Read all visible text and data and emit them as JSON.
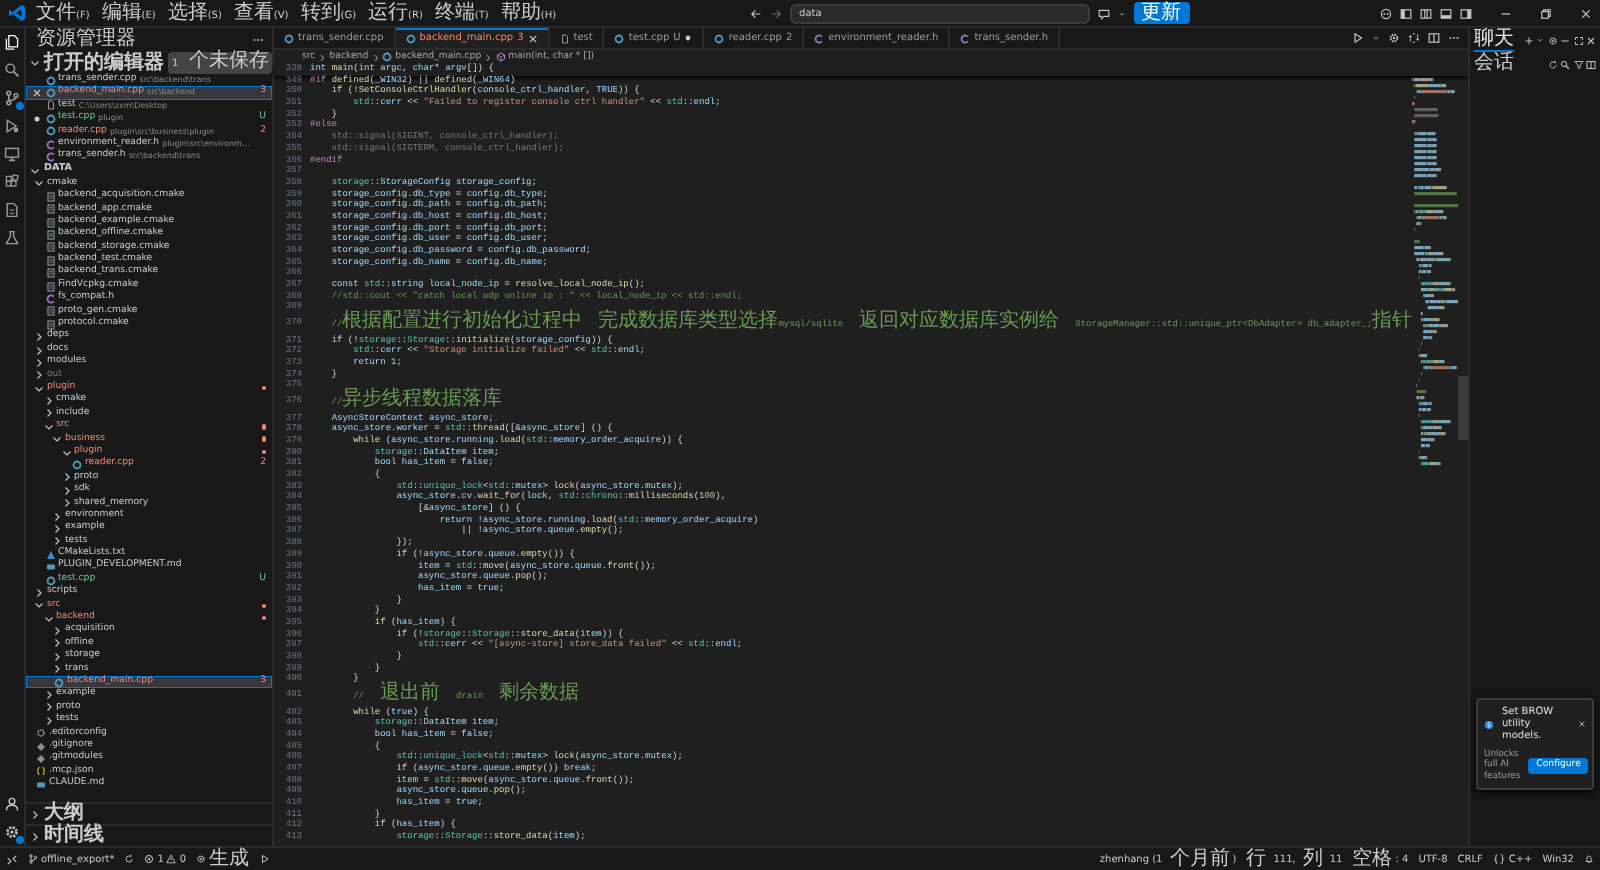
{
  "title_bar": {
    "menus": [
      "文件(F)",
      "编辑(E)",
      "选择(S)",
      "查看(V)",
      "转到(G)",
      "运行(R)",
      "终端(T)",
      "帮助(H)"
    ],
    "search": {
      "value": "data"
    },
    "update_button": "更新"
  },
  "activity_bar": {
    "items": [
      {
        "kind": "explorer",
        "selected": true,
        "badge": false
      },
      {
        "kind": "search",
        "selected": false,
        "badge": false
      },
      {
        "kind": "source-control",
        "selected": false,
        "badge": true
      },
      {
        "kind": "run-debug",
        "selected": false,
        "badge": false
      },
      {
        "kind": "remote",
        "selected": false,
        "badge": false
      },
      {
        "kind": "extensions",
        "selected": false,
        "badge": false
      },
      {
        "kind": "document",
        "selected": false,
        "badge": false
      },
      {
        "kind": "flask",
        "selected": false,
        "badge": false
      }
    ],
    "bottom": [
      {
        "kind": "account",
        "badge": false
      },
      {
        "kind": "settings",
        "badge": true
      }
    ]
  },
  "sidebar": {
    "title": "资源管理器",
    "open_editors": {
      "label": "打开的编辑器",
      "expanded": true,
      "badge": "1 个未保存",
      "items": [
        {
          "name": "trans_sender.cpp",
          "kind": "cpp",
          "path": "src\\backend\\trans",
          "selected": false,
          "dirty": false
        },
        {
          "name": "backend_main.cpp",
          "kind": "cpp",
          "path": "src\\backend",
          "badge": "3",
          "error": true,
          "selected": true,
          "dirty": false
        },
        {
          "name": "test",
          "kind": "file",
          "path": "C:\\Users\\zxm\\Desktop",
          "selected": false,
          "dirty": false
        },
        {
          "name": "test.cpp",
          "kind": "cpp",
          "path": "plugin",
          "badge": "U",
          "untracked": true,
          "selected": false,
          "dirty": true
        },
        {
          "name": "reader.cpp",
          "kind": "cpp",
          "path": "plugin\\src\\business\\plugin",
          "badge": "2",
          "error": true,
          "selected": false,
          "dirty": false
        },
        {
          "name": "environment_reader.h",
          "kind": "h",
          "path": "plugin\\src\\environm…",
          "selected": false,
          "dirty": false
        },
        {
          "name": "trans_sender.h",
          "kind": "h",
          "path": "src\\backend\\trans",
          "selected": false,
          "dirty": false
        }
      ]
    },
    "workspace": {
      "label": "DATA",
      "expanded": true,
      "tree": [
        {
          "label": "cmake",
          "kind": "folder",
          "expanded": true,
          "selected": false,
          "children": [
            {
              "label": "backend_acquisition.cmake",
              "kind": "cmake",
              "selected": false
            },
            {
              "label": "backend_app.cmake",
              "kind": "cmake",
              "selected": false
            },
            {
              "label": "backend_example.cmake",
              "kind": "cmake",
              "selected": false
            },
            {
              "label": "backend_offline.cmake",
              "kind": "cmake",
              "selected": false
            },
            {
              "label": "backend_storage.cmake",
              "kind": "cmake",
              "selected": false
            },
            {
              "label": "backend_test.cmake",
              "kind": "cmake",
              "selected": false
            },
            {
              "label": "backend_trans.cmake",
              "kind": "cmake",
              "selected": false
            },
            {
              "label": "FindVcpkg.cmake",
              "kind": "cmake",
              "selected": false
            },
            {
              "label": "fs_compat.h",
              "kind": "h",
              "selected": false
            },
            {
              "label": "proto_gen.cmake",
              "kind": "cmake",
              "selected": false
            },
            {
              "label": "protocol.cmake",
              "kind": "cmake",
              "selected": false
            }
          ]
        },
        {
          "label": "deps",
          "kind": "folder",
          "expanded": false,
          "selected": false
        },
        {
          "label": "docs",
          "kind": "folder",
          "expanded": false,
          "selected": false
        },
        {
          "label": "modules",
          "kind": "folder",
          "expanded": false,
          "selected": false
        },
        {
          "label": "out",
          "kind": "folder",
          "expanded": false,
          "selected": false,
          "ignored": true
        },
        {
          "label": "plugin",
          "kind": "folder",
          "expanded": true,
          "selected": false,
          "error": true,
          "children": [
            {
              "label": "cmake",
              "kind": "folder",
              "expanded": false,
              "selected": false
            },
            {
              "label": "include",
              "kind": "folder",
              "expanded": false,
              "selected": false
            },
            {
              "label": "src",
              "kind": "folder",
              "expanded": true,
              "selected": false,
              "error": true,
              "children": [
                {
                  "label": "business",
                  "kind": "folder",
                  "expanded": true,
                  "selected": false,
                  "error": true,
                  "children": [
                    {
                      "label": "plugin",
                      "kind": "folder",
                      "expanded": true,
                      "selected": false,
                      "error": true,
                      "children": [
                        {
                          "label": "reader.cpp",
                          "kind": "cpp",
                          "selected": false,
                          "error": true,
                          "badge": "2"
                        }
                      ]
                    },
                    {
                      "label": "proto",
                      "kind": "folder",
                      "expanded": false,
                      "selected": false
                    },
                    {
                      "label": "sdk",
                      "kind": "folder",
                      "expanded": false,
                      "selected": false
                    },
                    {
                      "label": "shared_memory",
                      "kind": "folder",
                      "expanded": false,
                      "selected": false
                    }
                  ]
                },
                {
                  "label": "environment",
                  "kind": "folder",
                  "expanded": false,
                  "selected": false
                },
                {
                  "label": "example",
                  "kind": "folder",
                  "expanded": false,
                  "selected": false
                },
                {
                  "label": "tests",
                  "kind": "folder",
                  "expanded": false,
                  "selected": false
                }
              ]
            },
            {
              "label": "CMakeLists.txt",
              "kind": "txt",
              "selected": false
            },
            {
              "label": "PLUGIN_DEVELOPMENT.md",
              "kind": "md",
              "selected": false
            },
            {
              "label": "test.cpp",
              "kind": "cpp",
              "selected": false,
              "untracked": true,
              "badge": "U"
            }
          ]
        },
        {
          "label": "scripts",
          "kind": "folder",
          "expanded": false,
          "selected": false
        },
        {
          "label": "src",
          "kind": "folder",
          "expanded": true,
          "selected": false,
          "error": true,
          "children": [
            {
              "label": "backend",
              "kind": "folder",
              "expanded": true,
              "selected": false,
              "error": true,
              "children": [
                {
                  "label": "acquisition",
                  "kind": "folder",
                  "expanded": false,
                  "selected": false
                },
                {
                  "label": "offline",
                  "kind": "folder",
                  "expanded": false,
                  "selected": false
                },
                {
                  "label": "storage",
                  "kind": "folder",
                  "expanded": false,
                  "selected": false
                },
                {
                  "label": "trans",
                  "kind": "folder",
                  "expanded": false,
                  "selected": false
                },
                {
                  "label": "backend_main.cpp",
                  "kind": "cpp",
                  "selected": true,
                  "error": true,
                  "badge": "3"
                }
              ]
            },
            {
              "label": "example",
              "kind": "folder",
              "expanded": false,
              "selected": false
            },
            {
              "label": "proto",
              "kind": "folder",
              "expanded": false,
              "selected": false
            },
            {
              "label": "tests",
              "kind": "folder",
              "expanded": false,
              "selected": false
            }
          ]
        },
        {
          "label": ".editorconfig",
          "kind": "config",
          "selected": false
        },
        {
          "label": ".gitignore",
          "kind": "git",
          "selected": false
        },
        {
          "label": ".gitmodules",
          "kind": "git",
          "selected": false
        },
        {
          "label": ".mcp.json",
          "kind": "json",
          "selected": false
        },
        {
          "label": "CLAUDE.md",
          "kind": "md",
          "selected": false
        }
      ]
    },
    "sections": [
      {
        "label": "大纲",
        "expanded": false
      },
      {
        "label": "时间线",
        "expanded": false
      }
    ]
  },
  "editor": {
    "tabs": [
      {
        "label": "trans_sender.cpp",
        "kind": "cpp",
        "selected": false,
        "dirty": false
      },
      {
        "label": "backend_main.cpp",
        "kind": "cpp",
        "selected": true,
        "dirty": false,
        "badge": "3",
        "error": true
      },
      {
        "label": "test",
        "kind": "file",
        "selected": false,
        "dirty": false
      },
      {
        "label": "test.cpp",
        "kind": "cpp",
        "selected": false,
        "dirty": true,
        "badge": "U",
        "untracked": true
      },
      {
        "label": "reader.cpp",
        "kind": "cpp",
        "selected": false,
        "dirty": false,
        "badge": "2",
        "error": true
      },
      {
        "label": "environment_reader.h",
        "kind": "h",
        "selected": false,
        "dirty": false
      },
      {
        "label": "trans_sender.h",
        "kind": "h",
        "selected": false,
        "dirty": false
      }
    ],
    "breadcrumb": [
      {
        "text": "src",
        "kind": "folder"
      },
      {
        "text": "backend",
        "kind": "folder"
      },
      {
        "text": "backend_main.cpp",
        "kind": "cpp"
      },
      {
        "text": "main(int, char * [])",
        "kind": "function"
      }
    ],
    "sticky": {
      "number": "338",
      "kind": "code",
      "text": "int main(int argc, char* argv[]) {"
    },
    "lines": [
      {
        "number": "349",
        "kind": "preprocessor",
        "text": "#if defined(_WIN32) || defined(_WIN64)"
      },
      {
        "number": "350",
        "kind": "code",
        "text": "    if (!SetConsoleCtrlHandler(console_ctrl_handler, TRUE)) {"
      },
      {
        "number": "351",
        "kind": "code",
        "text": "        std::cerr << \"Failed to register console ctrl handler\" << std::endl;"
      },
      {
        "number": "352",
        "kind": "code",
        "text": "    }"
      },
      {
        "number": "353",
        "kind": "preprocessor",
        "text": "#else"
      },
      {
        "number": "354",
        "kind": "inactive",
        "text": "    std::signal(SIGINT, console_ctrl_handler);"
      },
      {
        "number": "355",
        "kind": "inactive",
        "text": "    std::signal(SIGTERM, console_ctrl_handler);"
      },
      {
        "number": "356",
        "kind": "preprocessor",
        "text": "#endif"
      },
      {
        "number": "357",
        "kind": "blank"
      },
      {
        "number": "358",
        "kind": "code",
        "text": "    storage::StorageConfig storage_config;"
      },
      {
        "number": "359",
        "kind": "code",
        "text": "    storage_config.db_type = config.db_type;"
      },
      {
        "number": "360",
        "kind": "code",
        "text": "    storage_config.db_path = config.db_path;"
      },
      {
        "number": "361",
        "kind": "code",
        "text": "    storage_config.db_host = config.db_host;"
      },
      {
        "number": "362",
        "kind": "code",
        "text": "    storage_config.db_port = config.db_port;"
      },
      {
        "number": "363",
        "kind": "code",
        "text": "    storage_config.db_user = config.db_user;"
      },
      {
        "number": "364",
        "kind": "code",
        "text": "    storage_config.db_password = config.db_password;"
      },
      {
        "number": "365",
        "kind": "code",
        "text": "    storage_config.db_name = config.db_name;"
      },
      {
        "number": "366",
        "kind": "blank"
      },
      {
        "number": "367",
        "kind": "code",
        "text": "    const std::string local_node_ip = resolve_local_node_ip();"
      },
      {
        "number": "368",
        "kind": "comment",
        "text": "    //std::cout << \"catch local udp online ip : \" << local_node_ip << std::endl;"
      },
      {
        "number": "369",
        "kind": "blank"
      },
      {
        "number": "370",
        "kind": "comment",
        "text": "    //根据配置进行初始化过程中 完成数据库类型选择mysql/sqlite 返回对应数据库实例给 StorageManager::std::unique_ptr<DbAdapter> db_adapter_;指针"
      },
      {
        "number": "371",
        "kind": "code",
        "text": "    if (!storage::Storage::initialize(storage_config)) {"
      },
      {
        "number": "372",
        "kind": "code",
        "text": "        std::cerr << \"Storage initialize failed\" << std::endl;"
      },
      {
        "number": "373",
        "kind": "code",
        "text": "        return 1;"
      },
      {
        "number": "374",
        "kind": "code",
        "text": "    }"
      },
      {
        "number": "375",
        "kind": "blank"
      },
      {
        "number": "376",
        "kind": "comment",
        "text": "    //异步线程数据落库"
      },
      {
        "number": "377",
        "kind": "code",
        "text": "    AsyncStoreContext async_store;"
      },
      {
        "number": "378",
        "kind": "code",
        "text": "    async_store.worker = std::thread([&async_store] () {"
      },
      {
        "number": "379",
        "kind": "code",
        "text": "        while (async_store.running.load(std::memory_order_acquire)) {"
      },
      {
        "number": "380",
        "kind": "code",
        "text": "            storage::DataItem item;"
      },
      {
        "number": "381",
        "kind": "code",
        "text": "            bool has_item = false;"
      },
      {
        "number": "382",
        "kind": "code",
        "text": "            {"
      },
      {
        "number": "383",
        "kind": "code",
        "text": "                std::unique_lock<std::mutex> lock(async_store.mutex);"
      },
      {
        "number": "384",
        "kind": "code",
        "text": "                async_store.cv.wait_for(lock, std::chrono::milliseconds(100),"
      },
      {
        "number": "385",
        "kind": "code",
        "text": "                    [&async_store] () {"
      },
      {
        "number": "386",
        "kind": "code",
        "text": "                        return !async_store.running.load(std::memory_order_acquire)"
      },
      {
        "number": "387",
        "kind": "code",
        "text": "                            || !async_store.queue.empty();"
      },
      {
        "number": "388",
        "kind": "code",
        "text": "                });"
      },
      {
        "number": "389",
        "kind": "code",
        "text": "                if (!async_store.queue.empty()) {"
      },
      {
        "number": "390",
        "kind": "code",
        "text": "                    item = std::move(async_store.queue.front());"
      },
      {
        "number": "391",
        "kind": "code",
        "text": "                    async_store.queue.pop();"
      },
      {
        "number": "392",
        "kind": "code",
        "text": "                    has_item = true;"
      },
      {
        "number": "393",
        "kind": "code",
        "text": "                }"
      },
      {
        "number": "394",
        "kind": "code",
        "text": "            }"
      },
      {
        "number": "395",
        "kind": "code",
        "text": "            if (has_item) {"
      },
      {
        "number": "396",
        "kind": "code",
        "text": "                if (!storage::Storage::store_data(item)) {"
      },
      {
        "number": "397",
        "kind": "code",
        "text": "                    std::cerr << \"[async-store] store_data failed\" << std::endl;"
      },
      {
        "number": "398",
        "kind": "code",
        "text": "                }"
      },
      {
        "number": "399",
        "kind": "code",
        "text": "            }"
      },
      {
        "number": "400",
        "kind": "code",
        "text": "        }"
      },
      {
        "number": "401",
        "kind": "comment",
        "text": "        // 退出前 drain 剩余数据"
      },
      {
        "number": "402",
        "kind": "code",
        "text": "        while (true) {"
      },
      {
        "number": "403",
        "kind": "code",
        "text": "            storage::DataItem item;"
      },
      {
        "number": "404",
        "kind": "code",
        "text": "            bool has_item = false;"
      },
      {
        "number": "405",
        "kind": "code",
        "text": "            {"
      },
      {
        "number": "406",
        "kind": "code",
        "text": "                std::unique_lock<std::mutex> lock(async_store.mutex);"
      },
      {
        "number": "407",
        "kind": "code",
        "text": "                if (async_store.queue.empty()) break;"
      },
      {
        "number": "408",
        "kind": "code",
        "text": "                item = std::move(async_store.queue.front());"
      },
      {
        "number": "409",
        "kind": "code",
        "text": "                async_store.queue.pop();"
      },
      {
        "number": "410",
        "kind": "code",
        "text": "                has_item = true;"
      },
      {
        "number": "411",
        "kind": "code",
        "text": "            }"
      },
      {
        "number": "412",
        "kind": "code",
        "text": "            if (has_item) {"
      },
      {
        "number": "413",
        "kind": "code",
        "text": "                storage::Storage::store_data(item);"
      }
    ]
  },
  "right_panel": {
    "tabs": [
      {
        "label": "聊天",
        "selected": true
      }
    ],
    "subtitle": "会话",
    "notification": {
      "title": "Set BROW utility models.",
      "message": "Unlocks full AI features",
      "button": "Configure"
    }
  },
  "status_bar": {
    "branch": "offline_export*",
    "errors": "1",
    "warnings": "0",
    "build": "生成",
    "right": [
      "zhenhang (1 个月前)",
      "行 111, 列 11",
      "空格: 4",
      "UTF-8",
      "CRLF",
      "{} C++",
      "Win32"
    ]
  }
}
